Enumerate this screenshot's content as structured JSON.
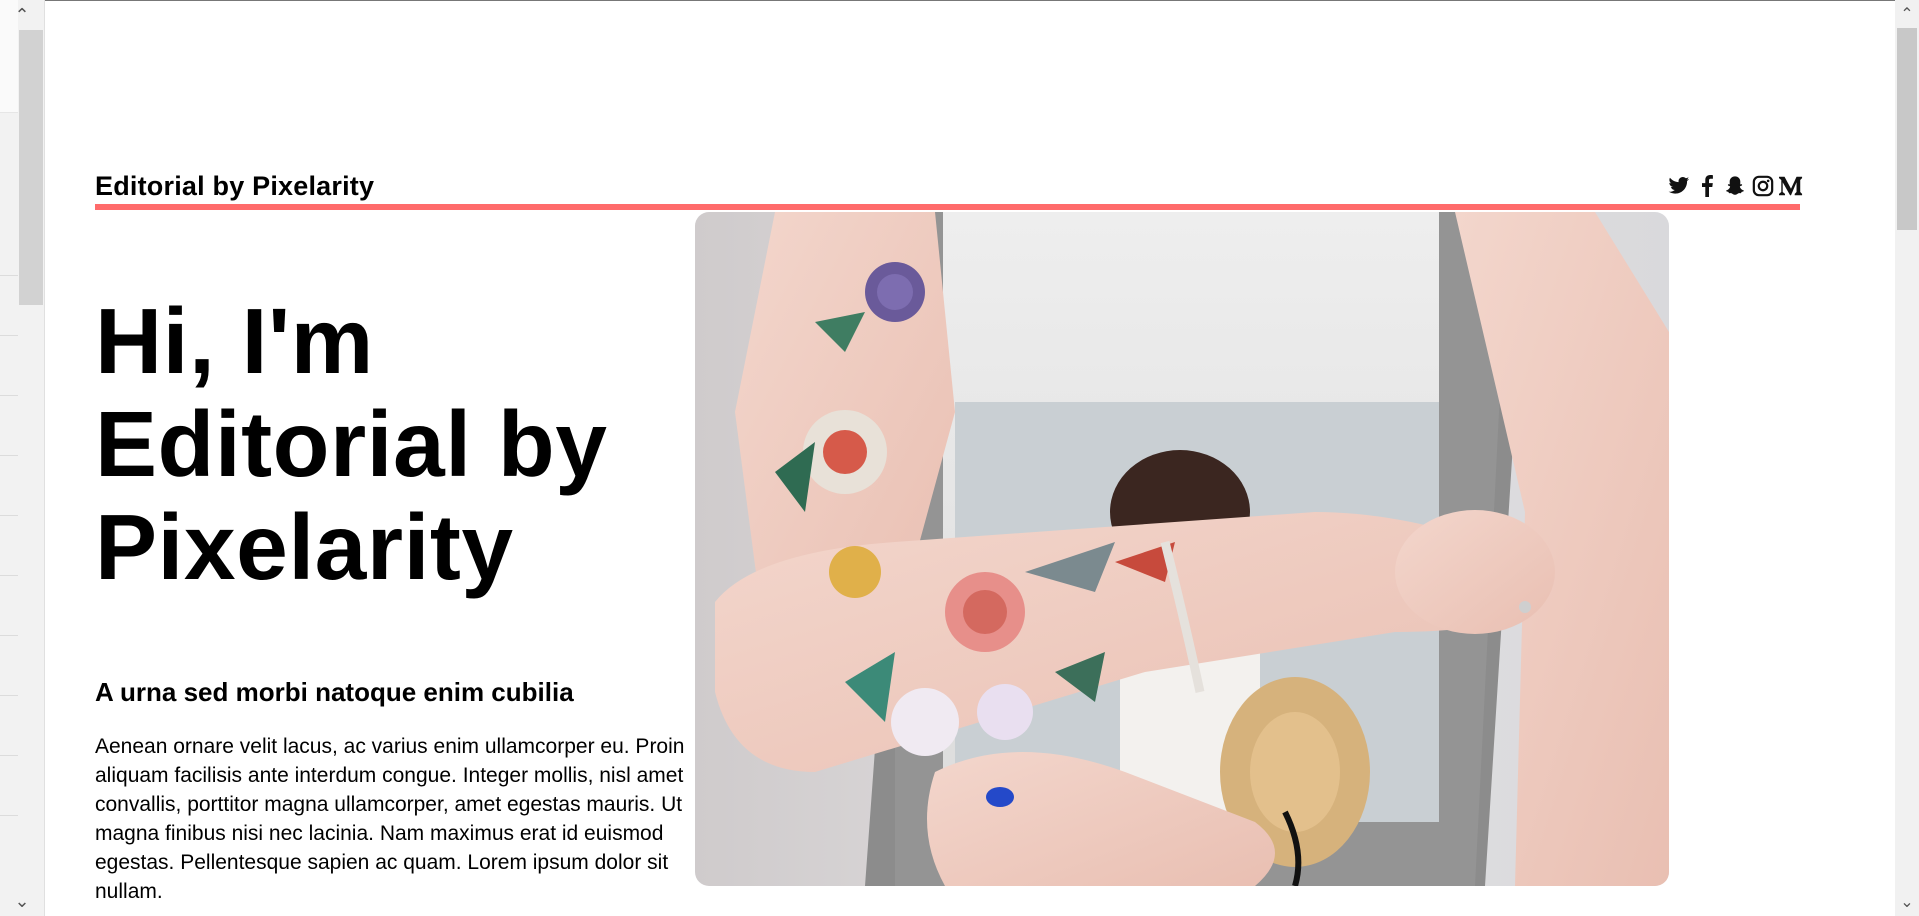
{
  "header": {
    "brand": "Editorial by Pixelarity",
    "social_icons": [
      "twitter-icon",
      "facebook-icon",
      "snapchat-icon",
      "instagram-icon",
      "medium-icon"
    ]
  },
  "hero": {
    "title_lines": [
      "Hi, I'm",
      "Editorial by",
      "Pixelarity"
    ],
    "subheading": "A urna sed morbi natoque enim cubilia",
    "body": "Aenean ornare velit lacus, ac varius enim ullamcorper eu. Proin aliquam facilisis ante interdum congue. Integer mollis, nisl amet convallis, porttitor magna ullamcorper, amet egestas mauris. Ut magna finibus nisi nec lacinia. Nam maximus erat id euismod egestas. Pellentesque sapien ac quam. Lorem ipsum dolor sit nullam."
  },
  "colors": {
    "accent": "#ff6b6b",
    "text": "#000000",
    "background": "#ffffff"
  }
}
